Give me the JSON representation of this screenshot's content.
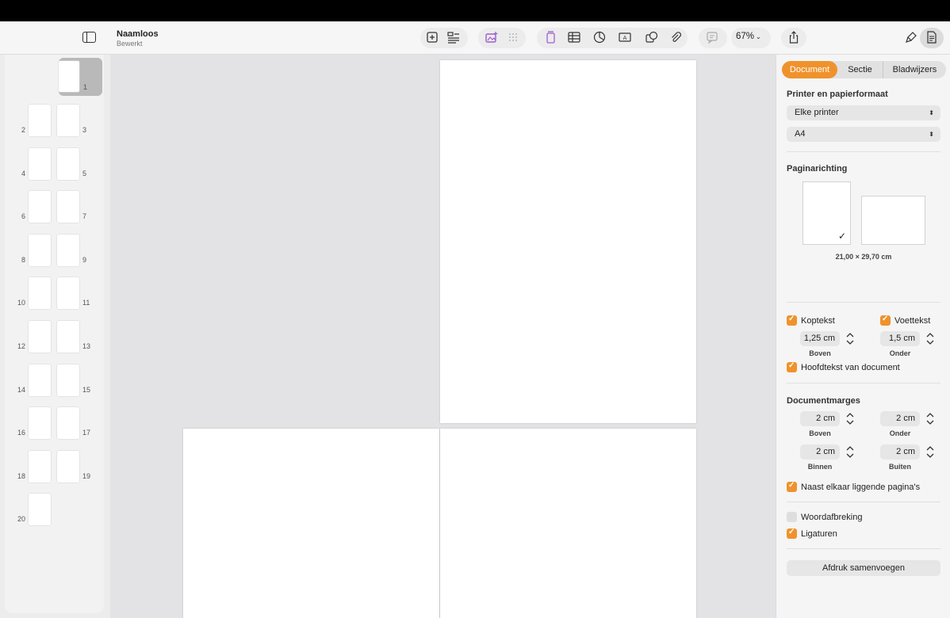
{
  "window": {
    "title": "Naamloos",
    "subtitle": "Bewerkt"
  },
  "toolbar": {
    "zoom": "67%",
    "icons": [
      "sidebar-icon",
      "add-page-icon",
      "text-format-icon",
      "media-icon",
      "grid-icon",
      "page-color-icon",
      "table-icon",
      "chart-icon",
      "textbox-icon",
      "shape-icon",
      "attachment-icon",
      "comment-icon",
      "share-icon",
      "format-brush-icon",
      "document-inspector-icon"
    ],
    "accent": "#b07ad6"
  },
  "thumbnails": {
    "pages": [
      "1",
      "2",
      "3",
      "4",
      "5",
      "6",
      "7",
      "8",
      "9",
      "10",
      "11",
      "12",
      "13",
      "14",
      "15",
      "16",
      "17",
      "18",
      "19",
      "20"
    ],
    "selected": "1"
  },
  "inspector": {
    "tabs": [
      {
        "label": "Document",
        "active": true
      },
      {
        "label": "Sectie",
        "active": false
      },
      {
        "label": "Bladwijzers",
        "active": false
      }
    ],
    "printer_section": {
      "label": "Printer en papierformaat",
      "printer": "Elke printer",
      "paper": "A4"
    },
    "orientation": {
      "label": "Paginarichting",
      "selected": "portrait",
      "size": "21,00 × 29,70 cm"
    },
    "header": {
      "label": "Koptekst",
      "checked": true,
      "value": "1,25 cm",
      "caption": "Boven"
    },
    "footer": {
      "label": "Voettekst",
      "checked": true,
      "value": "1,5 cm",
      "caption": "Onder"
    },
    "body_text": {
      "label": "Hoofdtekst van document",
      "checked": true
    },
    "margins": {
      "label": "Documentmarges",
      "top": {
        "value": "2 cm",
        "caption": "Boven"
      },
      "bottom": {
        "value": "2 cm",
        "caption": "Onder"
      },
      "inside": {
        "value": "2 cm",
        "caption": "Binnen"
      },
      "outside": {
        "value": "2 cm",
        "caption": "Buiten"
      }
    },
    "facing_pages": {
      "label": "Naast elkaar liggende pagina's",
      "checked": true
    },
    "hyphenation": {
      "label": "Woordafbreking",
      "checked": false
    },
    "ligatures": {
      "label": "Ligaturen",
      "checked": true
    },
    "mail_merge": "Afdruk samenvoegen",
    "accent": "#f0922c"
  }
}
